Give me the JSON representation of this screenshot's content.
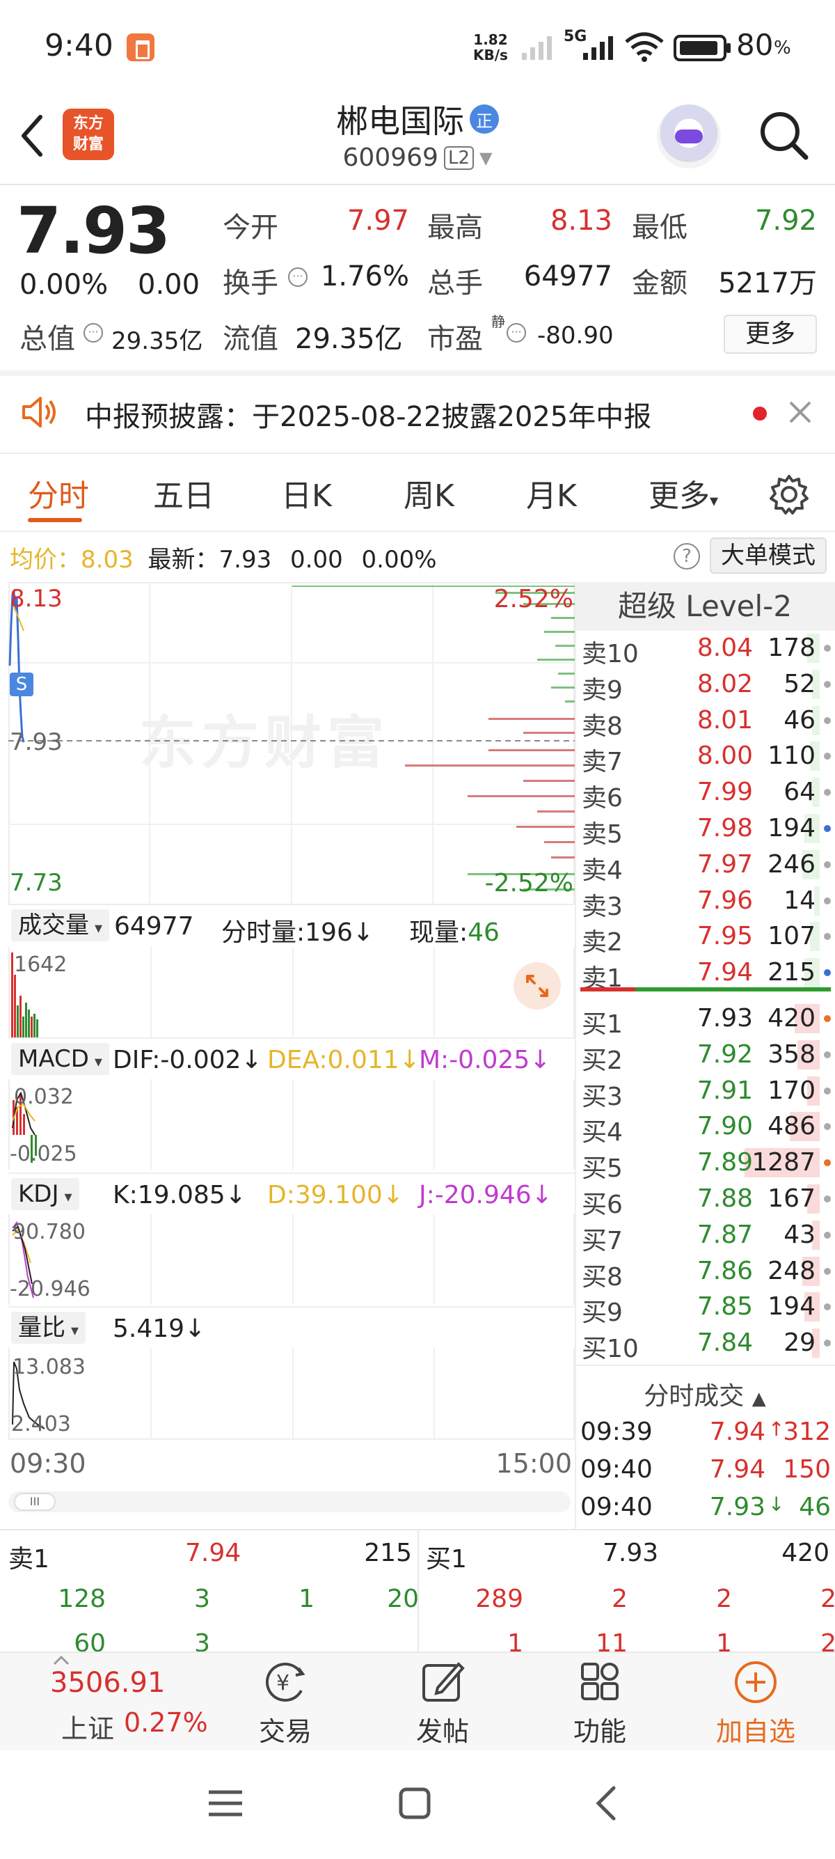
{
  "status_bar": {
    "time": "9:40",
    "net_speed_value": "1.82",
    "net_speed_unit": "KB/s",
    "network": "5G",
    "battery": "80",
    "battery_sym": "%"
  },
  "header": {
    "logo_line1": "东方",
    "logo_line2": "财富",
    "stock_name": "郴电国际",
    "badge": "正",
    "stock_code": "600969",
    "level_badge": "L2"
  },
  "quote": {
    "price": "7.93",
    "change_pct": "0.00%",
    "change_val": "0.00",
    "open_label": "今开",
    "open": "7.97",
    "high_label": "最高",
    "high": "8.13",
    "low_label": "最低",
    "low": "7.92",
    "turnover_label": "换手",
    "turnover": "1.76%",
    "volume_label": "总手",
    "volume": "64977",
    "amount_label": "金额",
    "amount": "5217万",
    "mktcap_label": "总值",
    "mktcap": "29.35亿",
    "float_label": "流值",
    "float": "29.35亿",
    "pe_label": "市盈",
    "pe_sup": "静",
    "pe": "-80.90",
    "more_label": "更多"
  },
  "notice": {
    "text": "中报预披露：于2025-08-22披露2025年中报"
  },
  "tabs": [
    "分时",
    "五日",
    "日K",
    "周K",
    "月K",
    "更多"
  ],
  "info_line": {
    "avg_label": "均价：",
    "avg": "8.03",
    "latest_label": "最新：",
    "latest": "7.93",
    "chg": "0.00",
    "chg_pct": "0.00%",
    "help": "?",
    "big_order_mode": "大单模式"
  },
  "chart": {
    "price_high": "8.13",
    "price_mid": "7.93",
    "price_low": "7.73",
    "pct_high": "2.52%",
    "pct_low": "-2.52%",
    "s_marker": "S",
    "watermark": "东方财富"
  },
  "indicators": {
    "volume": {
      "select": "成交量",
      "total": "64977",
      "minute_label": "分时量:",
      "minute": "196",
      "arrow": "↓",
      "now_label": "现量:",
      "now": "46",
      "axis_max": "1642"
    },
    "macd": {
      "select": "MACD",
      "dif": "DIF:-0.002",
      "dea": "DEA:0.011",
      "m": "M:-0.025",
      "arrow": "↓",
      "axis_max": "0.032",
      "axis_min": "-0.025"
    },
    "kdj": {
      "select": "KDJ",
      "k": "K:19.085",
      "d": "D:39.100",
      "j": "J:-20.946",
      "arrow": "↓",
      "axis_max": "90.780",
      "axis_min": "-20.946"
    },
    "vol_ratio": {
      "select": "量比",
      "value": "5.419",
      "arrow": "↓",
      "axis_max": "13.083",
      "axis_min": "2.403"
    }
  },
  "time_axis": {
    "start": "09:30",
    "end": "15:00"
  },
  "scroll_handle": "III",
  "level2": {
    "title": "超级 Level-2",
    "sells": [
      {
        "label": "卖10",
        "price": "8.04",
        "vol": "178",
        "bar": 0.05,
        "dot": "gray"
      },
      {
        "label": "卖9",
        "price": "8.02",
        "vol": "52",
        "bar": 0.03,
        "dot": "gray"
      },
      {
        "label": "卖8",
        "price": "8.01",
        "vol": "46",
        "bar": 0.03,
        "dot": "gray"
      },
      {
        "label": "卖7",
        "price": "8.00",
        "vol": "110",
        "bar": 0.04,
        "dot": "gray"
      },
      {
        "label": "卖6",
        "price": "7.99",
        "vol": "64",
        "bar": 0.03,
        "dot": "gray"
      },
      {
        "label": "卖5",
        "price": "7.98",
        "vol": "194",
        "bar": 0.06,
        "dot": "blue"
      },
      {
        "label": "卖4",
        "price": "7.97",
        "vol": "246",
        "bar": 0.07,
        "dot": "gray"
      },
      {
        "label": "卖3",
        "price": "7.96",
        "vol": "14",
        "bar": 0.02,
        "dot": "gray"
      },
      {
        "label": "卖2",
        "price": "7.95",
        "vol": "107",
        "bar": 0.04,
        "dot": "gray"
      },
      {
        "label": "卖1",
        "price": "7.94",
        "vol": "215",
        "bar": 0.06,
        "dot": "blue"
      }
    ],
    "buys": [
      {
        "label": "买1",
        "price": "7.93",
        "vol": "420",
        "bar": 0.1,
        "dot": "orange"
      },
      {
        "label": "买2",
        "price": "7.92",
        "vol": "358",
        "bar": 0.09,
        "dot": "gray"
      },
      {
        "label": "买3",
        "price": "7.91",
        "vol": "170",
        "bar": 0.05,
        "dot": "gray"
      },
      {
        "label": "买4",
        "price": "7.90",
        "vol": "486",
        "bar": 0.12,
        "dot": "gray"
      },
      {
        "label": "买5",
        "price": "7.89",
        "vol": "1287",
        "bar": 0.3,
        "dot": "orange"
      },
      {
        "label": "买6",
        "price": "7.88",
        "vol": "167",
        "bar": 0.05,
        "dot": "gray"
      },
      {
        "label": "买7",
        "price": "7.87",
        "vol": "43",
        "bar": 0.03,
        "dot": "gray"
      },
      {
        "label": "买8",
        "price": "7.86",
        "vol": "248",
        "bar": 0.07,
        "dot": "gray"
      },
      {
        "label": "买9",
        "price": "7.85",
        "vol": "194",
        "bar": 0.06,
        "dot": "gray"
      },
      {
        "label": "买10",
        "price": "7.84",
        "vol": "29",
        "bar": 0.03,
        "dot": "gray"
      }
    ]
  },
  "trades": {
    "title": "分时成交",
    "rows": [
      {
        "time": "09:39",
        "price": "7.94",
        "dir": "↑",
        "vol": "312",
        "color": "red"
      },
      {
        "time": "09:40",
        "price": "7.94",
        "dir": "",
        "vol": "150",
        "color": "red"
      },
      {
        "time": "09:40",
        "price": "7.93",
        "dir": "↓",
        "vol": "46",
        "color": "green"
      }
    ]
  },
  "bottom_quote": {
    "sell_label": "卖1",
    "sell_price": "7.94",
    "sell_vol": "215",
    "buy_label": "买1",
    "buy_price": "7.93",
    "buy_vol": "420",
    "sell_orders": [
      "128",
      "3",
      "1",
      "20"
    ],
    "buy_orders": [
      "289",
      "2",
      "2",
      "2"
    ],
    "sell_orders2": [
      "60",
      "3"
    ],
    "buy_orders2": [
      "1",
      "11",
      "1",
      "2"
    ]
  },
  "bottom_nav": {
    "index_value": "3506.91",
    "index_name": "上证",
    "index_pct": "0.27%",
    "trade": "交易",
    "post": "发帖",
    "features": "功能",
    "add_watch": "加自选"
  },
  "colors": {
    "up": "#d8302e",
    "down": "#2e8b2e",
    "accent": "#e05a1a"
  }
}
